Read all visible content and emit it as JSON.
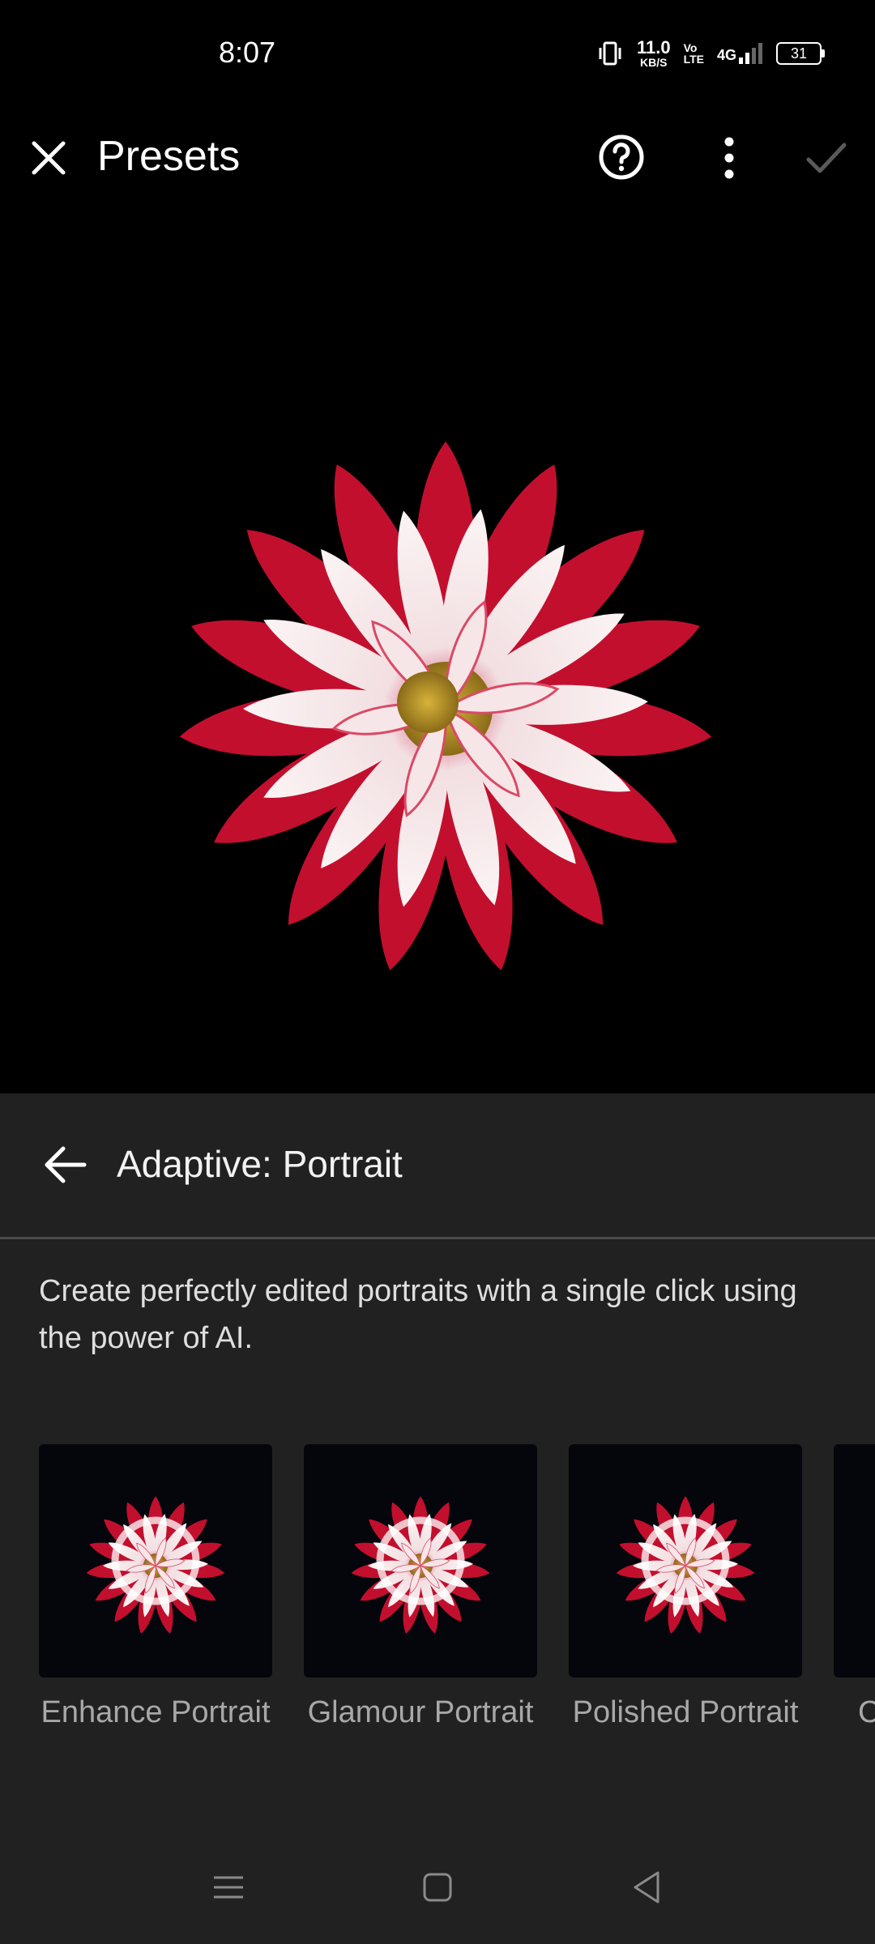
{
  "status_bar": {
    "time": "8:07",
    "net_speed_value": "11.0",
    "net_speed_unit": "KB/S",
    "volte_top": "Vo",
    "volte_bottom": "LTE",
    "network": "4G",
    "battery": "31"
  },
  "app_bar": {
    "title": "Presets",
    "close_icon": "close-icon",
    "help_icon": "help-circle-icon",
    "more_icon": "more-vertical-icon",
    "confirm_icon": "checkmark-icon"
  },
  "panel": {
    "title": "Adaptive: Portrait",
    "description": "Create perfectly edited portraits with a single click using the power of AI.",
    "presets": [
      {
        "label": "Enhance Portrait"
      },
      {
        "label": "Glamour Portrait"
      },
      {
        "label": "Polished Portrait"
      },
      {
        "label": "C"
      }
    ]
  },
  "colors": {
    "panel_bg": "#212121",
    "petal_red": "#c8102e",
    "petal_white": "#f4eaea",
    "center": "#c9a228"
  }
}
